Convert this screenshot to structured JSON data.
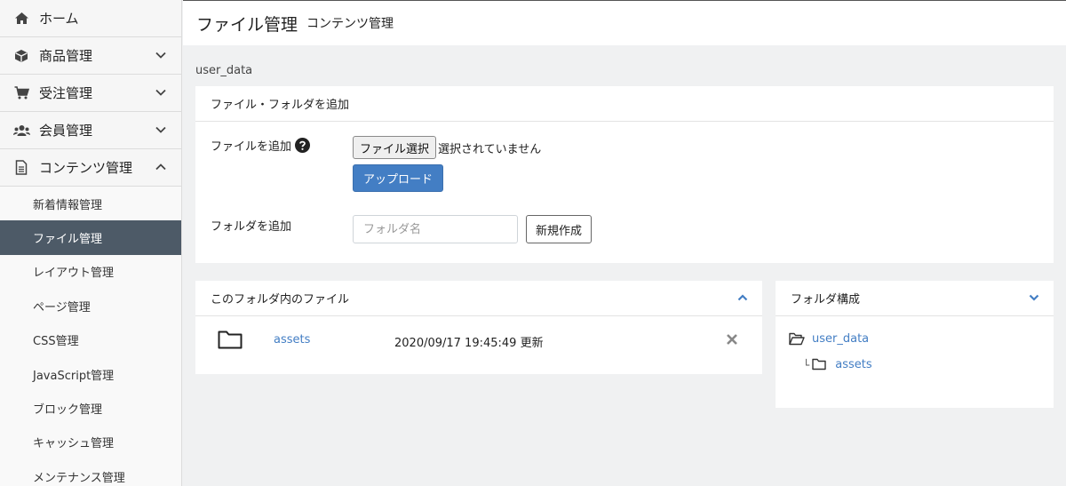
{
  "sidebar": {
    "items": [
      {
        "label": "ホーム",
        "icon": "home-icon"
      },
      {
        "label": "商品管理",
        "icon": "box-icon"
      },
      {
        "label": "受注管理",
        "icon": "cart-icon"
      },
      {
        "label": "会員管理",
        "icon": "users-icon"
      },
      {
        "label": "コンテンツ管理",
        "icon": "file-icon"
      }
    ],
    "sub_items": [
      {
        "label": "新着情報管理"
      },
      {
        "label": "ファイル管理"
      },
      {
        "label": "レイアウト管理"
      },
      {
        "label": "ページ管理"
      },
      {
        "label": "CSS管理"
      },
      {
        "label": "JavaScript管理"
      },
      {
        "label": "ブロック管理"
      },
      {
        "label": "キャッシュ管理"
      },
      {
        "label": "メンテナンス管理"
      }
    ]
  },
  "header": {
    "title": "ファイル管理",
    "subtitle": "コンテンツ管理"
  },
  "path_label": "user_data",
  "add_panel": {
    "title": "ファイル・フォルダを追加",
    "file_label": "ファイルを追加",
    "file_button": "ファイル選択",
    "file_status": "選択されていません",
    "upload_button": "アップロード",
    "folder_label": "フォルダを追加",
    "folder_placeholder": "フォルダ名",
    "create_button": "新規作成"
  },
  "files_panel": {
    "title": "このフォルダ内のファイル",
    "rows": [
      {
        "name": "assets",
        "updated": "2020/09/17 19:45:49 更新"
      }
    ]
  },
  "tree_panel": {
    "title": "フォルダ構成",
    "root": "user_data",
    "children": [
      "assets"
    ]
  },
  "colors": {
    "accent": "#437ec4",
    "active_bg": "#4d5a67"
  }
}
